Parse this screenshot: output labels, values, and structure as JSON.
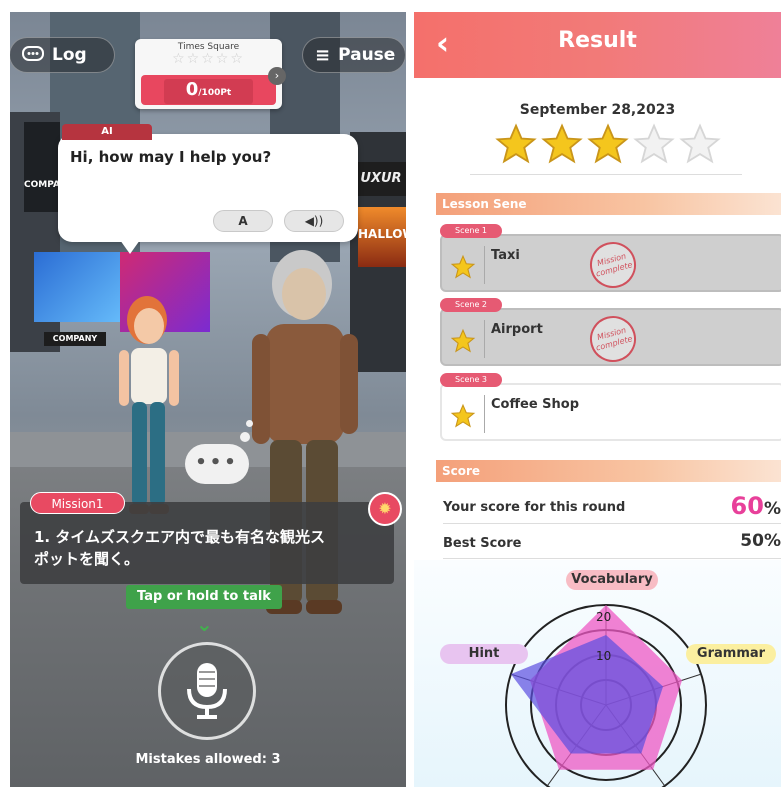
{
  "left": {
    "log_label": "Log",
    "pause_label": "Pause",
    "location": "Times Square",
    "score_value": "0",
    "score_unit": "/100Pt",
    "ai_tag": "AI",
    "ai_message": "Hi, how may I help you?",
    "translate_btn": "A",
    "audio_btn": "◀))",
    "thinking": "•••",
    "mission_badge": "Mission1",
    "mission_text_line1": "1. タイムズスクエア内で最も有名な観光ス",
    "mission_text_line2": "ポットを聞く。",
    "talk_hint": "Tap or hold to talk",
    "mistakes_allowed": "Mistakes allowed: 3",
    "billboard_1": "COMPANY",
    "billboard_2": "COMPANY",
    "billboard_3": "HALLOWE",
    "billboard_4": "UXUR"
  },
  "right": {
    "title": "Result",
    "date": "September 28,2023",
    "stars_filled": 3,
    "stars_total": 5,
    "lesson_section": "Lesson Sene",
    "scenes": [
      {
        "tag": "Scene 1",
        "name": "Taxi",
        "stamp": "Mission complete"
      },
      {
        "tag": "Scene 2",
        "name": "Airport",
        "stamp": "Mission complete"
      },
      {
        "tag": "Scene 3",
        "name": "Coffee Shop",
        "stamp": ""
      }
    ],
    "score_section": "Score",
    "this_round_label": "Your score for this round",
    "this_round_value": "60",
    "this_round_unit": "%",
    "best_label": "Best Score",
    "best_value": "50%",
    "radar": {
      "axes": [
        "Vocabulary",
        "Grammar",
        "",
        "",
        "Hint"
      ],
      "ring_labels": [
        "20",
        "10"
      ],
      "max": 20,
      "this_round": [
        20,
        16,
        16,
        16,
        16
      ],
      "best": [
        14,
        12,
        12,
        12,
        20
      ]
    }
  },
  "colors": {
    "accent_red": "#e84a62",
    "green": "#3fa24a",
    "score_pink": "#e8409a",
    "header_start": "#f4706b",
    "header_end": "#ef8098",
    "star_gold": "#f4c61d"
  }
}
